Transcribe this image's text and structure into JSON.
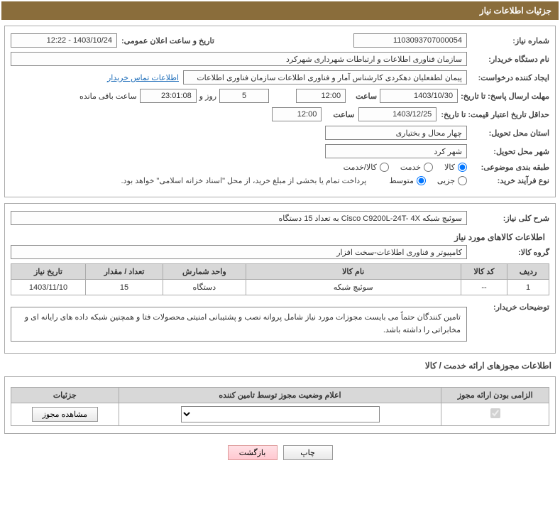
{
  "header_title": "جزئیات اطلاعات نیاز",
  "labels": {
    "need_no": "شماره نیاز:",
    "announce_dt": "تاریخ و ساعت اعلان عمومی:",
    "buyer_org": "نام دستگاه خریدار:",
    "requester": "ایجاد کننده درخواست:",
    "contact_link": "اطلاعات تماس خریدار",
    "reply_deadline": "مهلت ارسال پاسخ: تا تاریخ:",
    "time": "ساعت",
    "days_and": "روز و",
    "time_left": "ساعت باقی مانده",
    "price_valid_until": "حداقل تاریخ اعتبار قیمت: تا تاریخ:",
    "delivery_province": "استان محل تحویل:",
    "delivery_city": "شهر محل تحویل:",
    "subject_class": "طبقه بندی موضوعی:",
    "purchase_type": "نوع فرآیند خرید:",
    "need_desc": "شرح کلی نیاز:",
    "goods_info_title": "اطلاعات کالاهای مورد نیاز",
    "goods_group": "گروه کالا:",
    "buyer_notes": "توضیحات خریدار:",
    "license_section": "اطلاعات مجوزهای ارائه خدمت / کالا"
  },
  "values": {
    "need_no": "1103093707000054",
    "announce_dt": "1403/10/24 - 12:22",
    "buyer_org": "سازمان فناوری اطلاعات و ارتباطات شهرداری شهرکرد",
    "requester": "پیمان لطفعلیان دهکردی کارشناس آمار و فناوری اطلاعات سازمان فناوری اطلاعات",
    "reply_date": "1403/10/30",
    "reply_time": "12:00",
    "days_left": "5",
    "countdown": "23:01:08",
    "price_valid_date": "1403/12/25",
    "price_valid_time": "12:00",
    "province": "چهار محال و بختیاری",
    "city": "شهر کرد",
    "treasury_note": "پرداخت تمام یا بخشی از مبلغ خرید، از محل \"اسناد خزانه اسلامی\" خواهد بود.",
    "need_desc": "سوئیچ شبکه Cisco C9200L-24T- 4X به تعداد 15 دستگاه",
    "goods_group": "کامپیوتر و فناوری اطلاعات-سخت افزار",
    "buyer_notes": "تامین کنندگان حتماً می بایست مجوزات مورد نیاز شامل پروانه نصب و پشتیبانی امنیتی محصولات فتا و همچنین شبکه داده های رایانه ای و مخابراتی را داشته باشد."
  },
  "radios": {
    "subject": {
      "opt_goods": "کالا",
      "opt_service": "خدمت",
      "opt_both": "کالا/خدمت",
      "selected": "goods"
    },
    "purchase": {
      "opt_partial": "جزیی",
      "opt_medium": "متوسط",
      "selected": "medium"
    }
  },
  "goods_table": {
    "headers": {
      "row": "ردیف",
      "code": "کد کالا",
      "name": "نام کالا",
      "unit": "واحد شمارش",
      "qty": "تعداد / مقدار",
      "need_date": "تاریخ نیاز"
    },
    "rows": [
      {
        "row": "1",
        "code": "--",
        "name": "سوئیچ شبکه",
        "unit": "دستگاه",
        "qty": "15",
        "need_date": "1403/11/10"
      }
    ]
  },
  "license_table": {
    "headers": {
      "mandatory": "الزامی بودن ارائه مجوز",
      "status": "اعلام وضعیت مجوز توسط تامین کننده",
      "details": "جزئیات"
    },
    "view_btn": "مشاهده مجوز"
  },
  "buttons": {
    "print": "چاپ",
    "back": "بازگشت"
  }
}
